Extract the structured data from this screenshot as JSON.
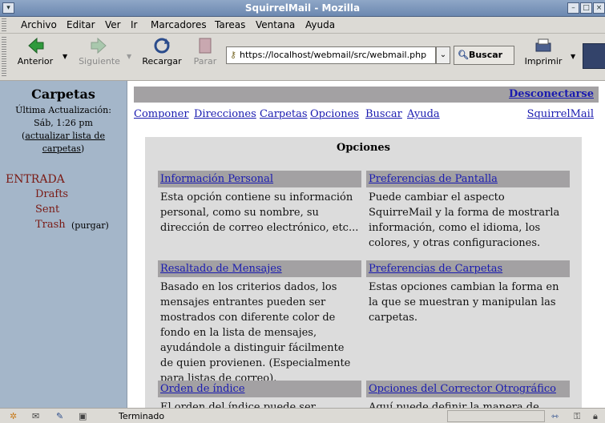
{
  "window": {
    "title": "SquirrelMail - Mozilla"
  },
  "menu": [
    "Archivo",
    "Editar",
    "Ver",
    "Ir",
    "Marcadores",
    "Tareas",
    "Ventana",
    "Ayuda"
  ],
  "nav": {
    "back": "Anterior",
    "forward": "Siguiente",
    "reload": "Recargar",
    "stop": "Parar",
    "url": "https://localhost/webmail/src/webmail.php",
    "search": "Buscar",
    "print": "Imprimir"
  },
  "sidebar": {
    "title": "Carpetas",
    "last_update_label": "Última Actualización:",
    "last_update_time": "Sáb, 1:26 pm",
    "refresh_link_1": "actualizar lista de",
    "refresh_link_2": "carpetas",
    "folders": [
      "ENTRADA",
      "Drafts",
      "Sent",
      "Trash"
    ],
    "purge": "purgar"
  },
  "main": {
    "logout": "Desconectarse",
    "links": [
      "Componer",
      "Direcciones",
      "Carpetas",
      "Opciones",
      "Buscar",
      "Ayuda"
    ],
    "brand_link": "SquirrelMail",
    "options_title": "Opciones",
    "options": [
      {
        "title": "Información Personal",
        "text": "Esta opción contiene su información personal, como su nombre, su dirección de correo electrónico, etc..."
      },
      {
        "title": "Preferencias de Pantalla",
        "text": "Puede cambiar el aspecto SquirreMail y la forma de mostrarla información, como el idioma, los colores, y otras configuraciones."
      },
      {
        "title": "Resaltado de Mensajes",
        "text": "Basado en los criterios dados, los mensajes entrantes pueden ser mostrados con diferente color de fondo en la lista de mensajes, ayudándole a distinguir fácilmente de quien provienen. (Especialmente para listas de correo)."
      },
      {
        "title": "Preferencias de Carpetas",
        "text": "Estas opciones cambian la forma en la que se muestran y manipulan las carpetas."
      },
      {
        "title": "Orden de índice",
        "text": "El orden del índice puede ser cambiado a"
      },
      {
        "title": "Opciones del Corrector Otrográfico",
        "text": "Aquí puede definir la manera de"
      }
    ]
  },
  "status": {
    "text": "Terminado"
  },
  "colors": {
    "sidebar": "#a4b6c9",
    "link": "#1a1bb0",
    "folder": "#7a1a14",
    "header_gray": "#a3a1a3"
  }
}
